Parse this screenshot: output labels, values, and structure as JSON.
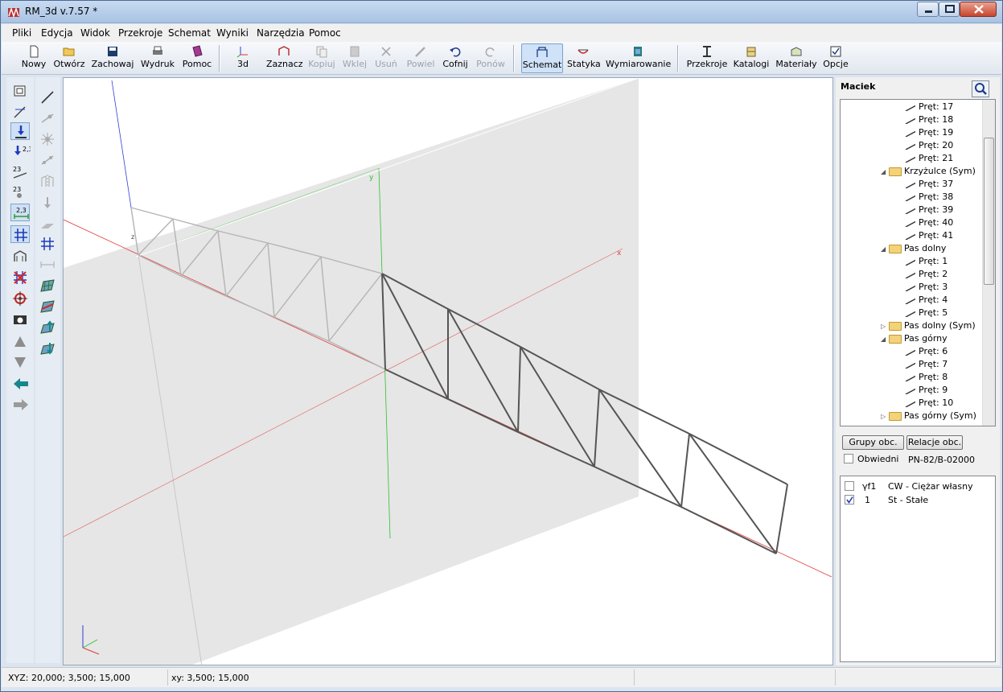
{
  "window": {
    "title": "RM_3d v.7.57 *"
  },
  "menu": [
    "Pliki",
    "Edycja",
    "Widok",
    "Przekroje",
    "Schemat",
    "Wyniki",
    "Narzędzia",
    "Pomoc"
  ],
  "toolbar": {
    "buttons": [
      {
        "label": "Nowy",
        "icon": "new-file-icon",
        "disabled": false
      },
      {
        "label": "Otwórz",
        "icon": "open-folder-icon",
        "disabled": false
      },
      {
        "label": "Zachowaj",
        "icon": "save-icon",
        "disabled": false
      },
      {
        "label": "Wydruk",
        "icon": "print-icon",
        "disabled": false
      },
      {
        "label": "Pomoc",
        "icon": "help-book-icon",
        "disabled": false
      },
      {
        "label": "3d",
        "icon": "axes-3d-icon",
        "disabled": false
      },
      {
        "label": "Zaznacz",
        "icon": "select-icon",
        "disabled": false
      },
      {
        "label": "Kopiuj",
        "icon": "copy-icon",
        "disabled": true
      },
      {
        "label": "Wklej",
        "icon": "paste-icon",
        "disabled": true
      },
      {
        "label": "Usuń",
        "icon": "delete-icon",
        "disabled": true
      },
      {
        "label": "Powiel",
        "icon": "duplicate-icon",
        "disabled": true
      },
      {
        "label": "Cofnij",
        "icon": "undo-icon",
        "disabled": false
      },
      {
        "label": "Ponów",
        "icon": "redo-icon",
        "disabled": true
      },
      {
        "label": "Schemat",
        "icon": "scheme-icon",
        "disabled": false,
        "active": true
      },
      {
        "label": "Statyka",
        "icon": "statics-icon",
        "disabled": false
      },
      {
        "label": "Wymiarowanie",
        "icon": "dimensioning-icon",
        "disabled": false
      },
      {
        "label": "Przekroje",
        "icon": "section-icon",
        "disabled": false
      },
      {
        "label": "Katalogi",
        "icon": "catalog-icon",
        "disabled": false
      },
      {
        "label": "Materiały",
        "icon": "materials-icon",
        "disabled": false
      },
      {
        "label": "Opcje",
        "icon": "options-icon",
        "disabled": false
      }
    ]
  },
  "left_tools": {
    "col1": [
      "properties-icon",
      "bar-edit-icon",
      "support-icon",
      "node-numbers-icon",
      "bar-numbers-icon",
      "node-labels-icon",
      "dimensions-icon",
      "grid-icon",
      "view-3d-icon",
      "hide-icon",
      "center-icon",
      "camera-icon",
      "arrow-up-icon",
      "arrow-down-icon",
      "arrow-left-icon",
      "arrow-right-icon"
    ],
    "col2": [
      "draw-bar-icon",
      "bar-hinge-icon",
      "node-icon",
      "bar-release-icon",
      "symmetry-icon",
      "load-icon",
      "surface-load-icon",
      "dimension-line-icon",
      "grid-plane-icon",
      "plane-xy-icon",
      "plane-xz-icon",
      "plane-up-icon",
      "plane-down-icon"
    ]
  },
  "tree": {
    "title": "Maciek",
    "rows": [
      {
        "label": "Pręt: 17",
        "type": "bar",
        "indent": 3
      },
      {
        "label": "Pręt: 18",
        "type": "bar",
        "indent": 3
      },
      {
        "label": "Pręt: 19",
        "type": "bar",
        "indent": 3
      },
      {
        "label": "Pręt: 20",
        "type": "bar",
        "indent": 3
      },
      {
        "label": "Pręt: 21",
        "type": "bar",
        "indent": 3
      },
      {
        "label": "Krzyżulce (Sym)",
        "type": "folder",
        "indent": 2,
        "expanded": true
      },
      {
        "label": "Pręt: 37",
        "type": "bar",
        "indent": 3
      },
      {
        "label": "Pręt: 38",
        "type": "bar",
        "indent": 3
      },
      {
        "label": "Pręt: 39",
        "type": "bar",
        "indent": 3
      },
      {
        "label": "Pręt: 40",
        "type": "bar",
        "indent": 3
      },
      {
        "label": "Pręt: 41",
        "type": "bar",
        "indent": 3
      },
      {
        "label": "Pas dolny",
        "type": "folder",
        "indent": 2,
        "expanded": true
      },
      {
        "label": "Pręt: 1",
        "type": "bar",
        "indent": 3
      },
      {
        "label": "Pręt: 2",
        "type": "bar",
        "indent": 3
      },
      {
        "label": "Pręt: 3",
        "type": "bar",
        "indent": 3
      },
      {
        "label": "Pręt: 4",
        "type": "bar",
        "indent": 3
      },
      {
        "label": "Pręt: 5",
        "type": "bar",
        "indent": 3
      },
      {
        "label": "Pas dolny (Sym)",
        "type": "folder",
        "indent": 2,
        "expanded": false
      },
      {
        "label": "Pas górny",
        "type": "folder",
        "indent": 2,
        "expanded": true
      },
      {
        "label": "Pręt: 6",
        "type": "bar",
        "indent": 3
      },
      {
        "label": "Pręt: 7",
        "type": "bar",
        "indent": 3
      },
      {
        "label": "Pręt: 8",
        "type": "bar",
        "indent": 3
      },
      {
        "label": "Pręt: 9",
        "type": "bar",
        "indent": 3
      },
      {
        "label": "Pręt: 10",
        "type": "bar",
        "indent": 3
      },
      {
        "label": "Pas górny (Sym)",
        "type": "folder",
        "indent": 2,
        "expanded": false
      }
    ]
  },
  "load_panel": {
    "groups_button": "Grupy obc.",
    "relations_button": "Relacje obc.",
    "envelope_label": "Obwiedni",
    "envelope_checked": false,
    "norm": "PN-82/B-02000",
    "loads": [
      {
        "id": "γf1",
        "name": "CW - Ciężar własny",
        "checked": false
      },
      {
        "id": "1",
        "name": "St - Stałe",
        "checked": true
      }
    ]
  },
  "viewport": {
    "axis_labels": {
      "y": "y",
      "x": "x",
      "z": "z"
    }
  },
  "status": {
    "xyz": "XYZ: 20,000; 3,500; 15,000",
    "xy": "xy: 3,500; 15,000"
  },
  "colors": {
    "axis_x": "#e23b3b",
    "axis_y": "#2fc12f",
    "axis_z": "#2f3fd8",
    "plane": "#e6e6e6",
    "truss": "#4a4a4a",
    "truss_ghost": "#bdbdbd"
  }
}
